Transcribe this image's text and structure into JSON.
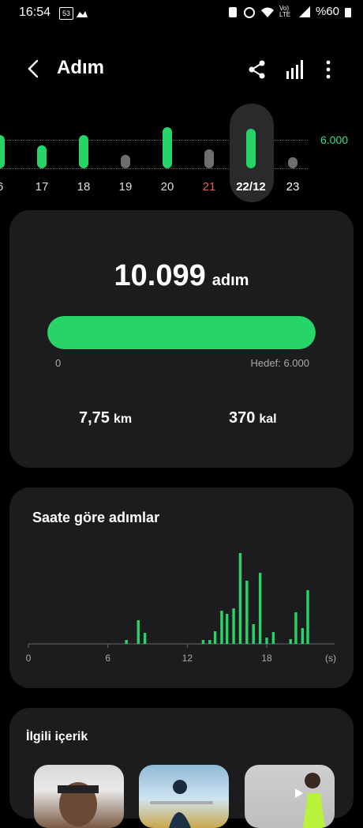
{
  "status": {
    "time": "16:54",
    "battery": "%60",
    "notif_badge": "53",
    "volte": "Vo) LTE"
  },
  "header": {
    "title": "Adım"
  },
  "week": {
    "goal_label": "6.000",
    "goal": 6000,
    "days": [
      {
        "label": "6",
        "level": 0.6,
        "color": "#26d468",
        "label_color": "#dddddd"
      },
      {
        "label": "17",
        "level": 0.42,
        "color": "#26d468",
        "label_color": "#dddddd"
      },
      {
        "label": "18",
        "level": 0.6,
        "color": "#26d468",
        "label_color": "#dddddd"
      },
      {
        "label": "19",
        "level": 0.25,
        "color": "#6e6e6e",
        "label_color": "#dddddd"
      },
      {
        "label": "20",
        "level": 0.75,
        "color": "#26d468",
        "label_color": "#dddddd"
      },
      {
        "label": "21",
        "level": 0.35,
        "color": "#6e6e6e",
        "label_color": "#e06060"
      },
      {
        "label": "22/12",
        "level": 0.72,
        "color": "#26d468",
        "label_color": "#ffffff",
        "selected": true
      },
      {
        "label": "23",
        "level": 0.18,
        "color": "#6e6e6e",
        "label_color": "#ffffff"
      }
    ]
  },
  "summary": {
    "steps": "10.099",
    "steps_unit": "adım",
    "progress_min": "0",
    "progress_goal": "Hedef: 6.000",
    "progress_fraction": 1.0,
    "distance": "7,75",
    "distance_unit": "km",
    "calories": "370",
    "calories_unit": "kal"
  },
  "hourly": {
    "title": "Saate göre adımlar",
    "chart_data": {
      "type": "bar",
      "xlabel": "",
      "ylabel": "",
      "x_ticks": [
        "0",
        "6",
        "12",
        "18",
        "(s)"
      ],
      "xlim": [
        0,
        24
      ],
      "bars": [
        {
          "x": 7.4,
          "v": 5
        },
        {
          "x": 8.3,
          "v": 30
        },
        {
          "x": 8.8,
          "v": 14
        },
        {
          "x": 13.2,
          "v": 5
        },
        {
          "x": 13.7,
          "v": 5
        },
        {
          "x": 14.1,
          "v": 16
        },
        {
          "x": 14.6,
          "v": 42
        },
        {
          "x": 15.0,
          "v": 38
        },
        {
          "x": 15.5,
          "v": 45
        },
        {
          "x": 16.0,
          "v": 115
        },
        {
          "x": 16.5,
          "v": 80
        },
        {
          "x": 17.0,
          "v": 25
        },
        {
          "x": 17.5,
          "v": 90
        },
        {
          "x": 18.0,
          "v": 8
        },
        {
          "x": 18.5,
          "v": 15
        },
        {
          "x": 19.8,
          "v": 6
        },
        {
          "x": 20.2,
          "v": 40
        },
        {
          "x": 20.7,
          "v": 20
        },
        {
          "x": 21.1,
          "v": 68
        }
      ]
    }
  },
  "related": {
    "title": "İlgili içerik"
  }
}
